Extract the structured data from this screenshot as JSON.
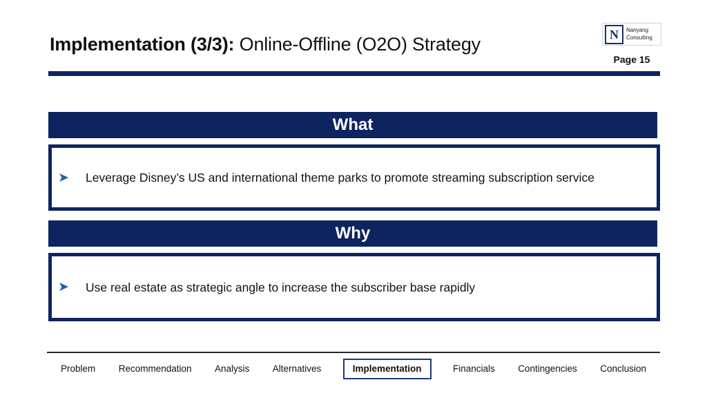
{
  "header": {
    "title_bold": "Implementation (3/3):",
    "title_rest": " Online-Offline (O2O) Strategy",
    "page_label": "Page 15"
  },
  "logo": {
    "mark_letter": "N",
    "line1": "Nanyang",
    "line2": "Consulting"
  },
  "sections": [
    {
      "heading": "What",
      "bullet_glyph": "➤",
      "bullet_text": "Leverage Disney’s US and international theme parks to promote streaming subscription service"
    },
    {
      "heading": "Why",
      "bullet_glyph": "➤",
      "bullet_text": "Use real estate as strategic angle to increase the subscriber base rapidly"
    }
  ],
  "footer": {
    "items": [
      {
        "label": "Problem",
        "active": false
      },
      {
        "label": "Recommendation",
        "active": false
      },
      {
        "label": "Analysis",
        "active": false
      },
      {
        "label": "Alternatives",
        "active": false
      },
      {
        "label": "Implementation",
        "active": true
      },
      {
        "label": "Financials",
        "active": false
      },
      {
        "label": "Contingencies",
        "active": false
      },
      {
        "label": "Conclusion",
        "active": false
      }
    ]
  },
  "colors": {
    "navy": "#0d2460",
    "bullet_blue": "#1f5fa8",
    "text": "#121212",
    "footer_rule": "#262626"
  }
}
